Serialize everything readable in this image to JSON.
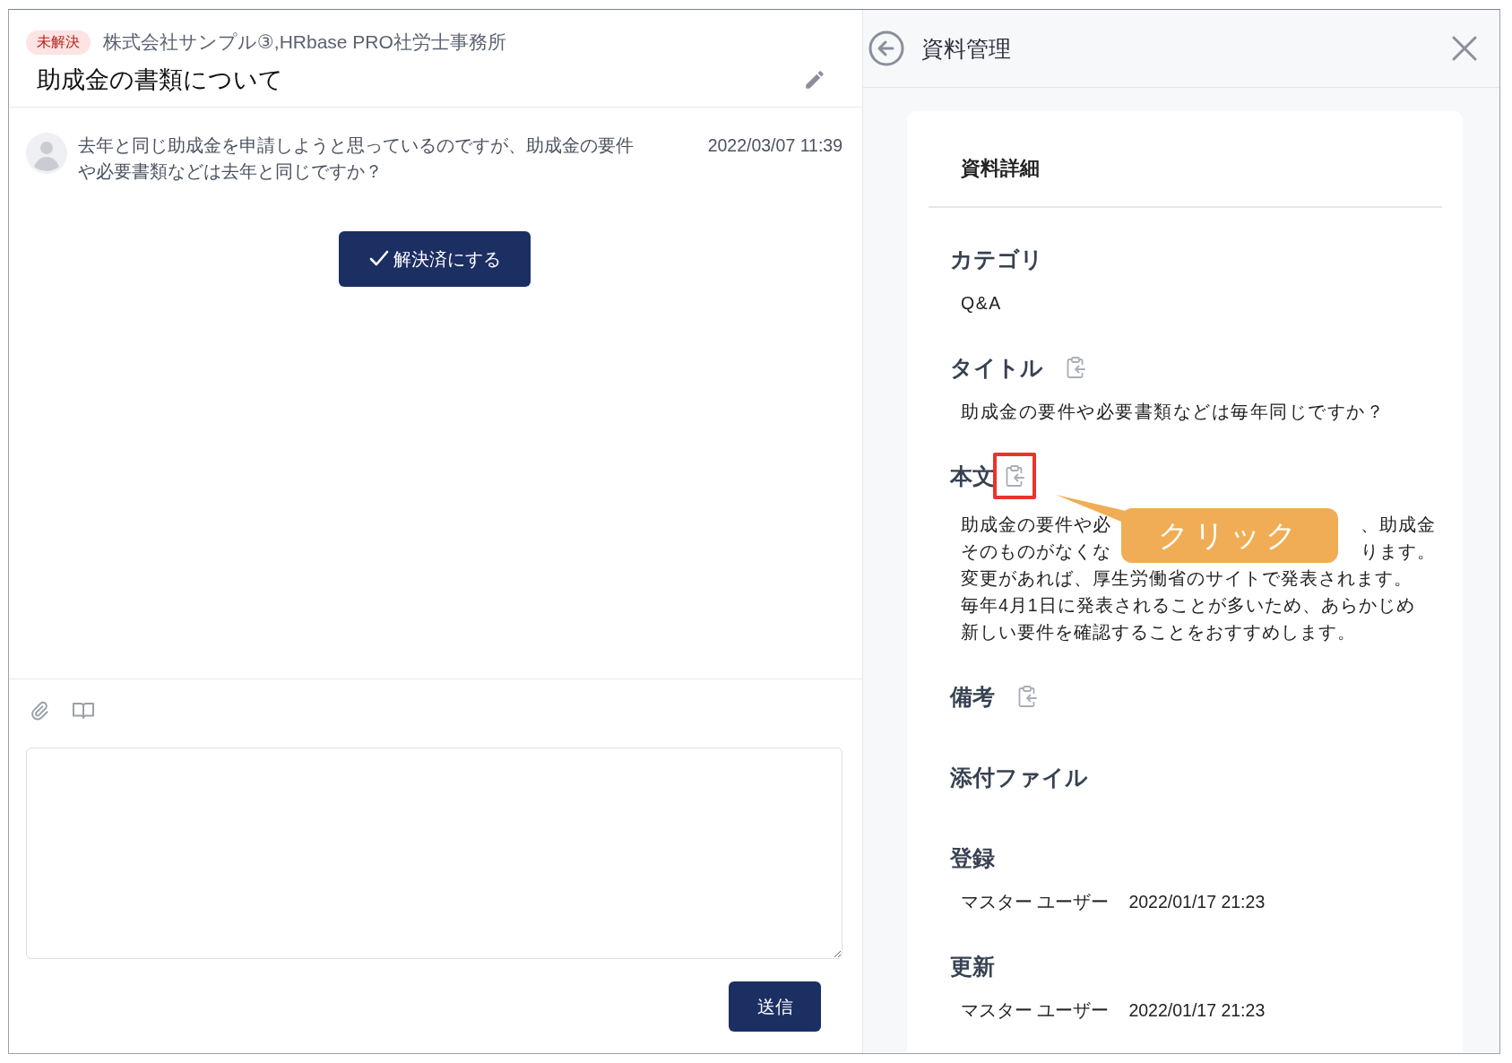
{
  "ticket": {
    "status": "未解決",
    "company": "株式会社サンプル③,HRbase PRO社労士事務所",
    "title": "助成金の書類について"
  },
  "messages": [
    {
      "text": "去年と同じ助成金を申請しようと思っているのですが、助成金の要件や必要書類などは去年と同じですか？",
      "time": "2022/03/07 11:39"
    }
  ],
  "resolve_button": "解決済にする",
  "composer": {
    "send_button": "送信"
  },
  "panel": {
    "title": "資料管理",
    "card_title": "資料詳細",
    "sections": [
      {
        "kind": "text",
        "label": "カテゴリ",
        "copyable": false,
        "value": "Q&A"
      },
      {
        "kind": "text",
        "label": "タイトル",
        "copyable": true,
        "highlighted": false,
        "value": "助成金の要件や必要書類などは毎年同じですか？"
      },
      {
        "kind": "lines",
        "label": "本文",
        "copyable": true,
        "highlighted": true,
        "lines": [
          {
            "parts": [
              "助成金の要件や必",
              "、助成金"
            ]
          },
          {
            "parts": [
              "そのものがなくな",
              "ります。"
            ]
          },
          {
            "parts": [
              "変更があれば、厚生労働省のサイトで発表されます。"
            ]
          },
          {
            "parts": [
              "毎年4月1日に発表されることが多いため、あらかじめ"
            ]
          },
          {
            "parts": [
              "新しい要件を確認することをおすすめします。"
            ]
          }
        ]
      },
      {
        "kind": "empty",
        "label": "備考",
        "copyable": true,
        "highlighted": false
      },
      {
        "kind": "empty",
        "label": "添付ファイル",
        "copyable": false
      },
      {
        "kind": "audit",
        "label": "登録",
        "user": "マスター ユーザー",
        "time": "2022/01/17 21:23"
      },
      {
        "kind": "audit",
        "label": "更新",
        "user": "マスター ユーザー",
        "time": "2022/01/17 21:23"
      }
    ]
  },
  "callout": {
    "text": "クリック"
  }
}
